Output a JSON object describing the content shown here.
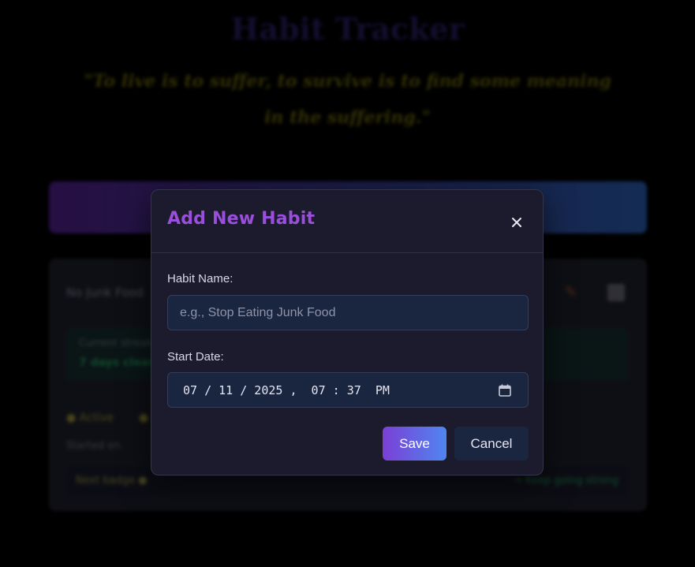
{
  "app": {
    "title": "Habit Tracker",
    "quote": "\"To live is to suffer, to survive is to find some meaning in the suffering.\""
  },
  "background_card": {
    "habit_name": "No Junk Food",
    "streak_caption": "Current streak",
    "streak_value": "7 days clean",
    "stat_1": "● Active",
    "stat_2": "●",
    "started_text": "Started on",
    "footer_left": "Next badge ●",
    "footer_right": "→ Keep going strong"
  },
  "modal": {
    "title": "Add New Habit",
    "close_icon": "close-icon",
    "habit_name_label": "Habit Name:",
    "habit_name_value": "",
    "habit_name_placeholder": "e.g., Stop Eating Junk Food",
    "start_date_label": "Start Date:",
    "start_date_value": "07 / 11 / 2025 ,  07 : 37  PM",
    "calendar_icon": "calendar-icon",
    "save_label": "Save",
    "cancel_label": "Cancel"
  },
  "colors": {
    "accent_purple": "#9a4fdc",
    "save_gradient_start": "#7b3fd6",
    "save_gradient_end": "#4f86f0",
    "modal_bg": "#1b1b2d",
    "input_bg": "#1a2540"
  }
}
